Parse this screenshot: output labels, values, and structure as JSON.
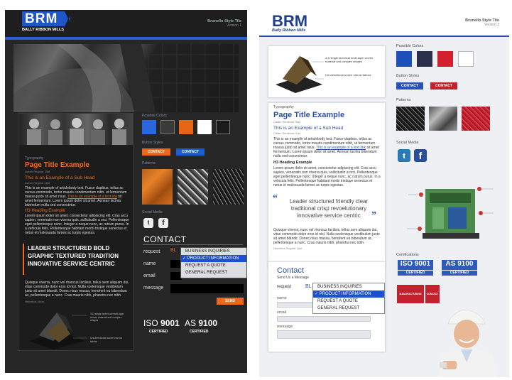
{
  "v1": {
    "logo": "BRM",
    "logo_sub": "BALLY RIBBON MILLS",
    "style_title": "Brunello Style Tile",
    "version": "Version 1",
    "possible_colors": "Possible Colors",
    "colors": [
      "#2b67dc",
      "#3a3a3a",
      "#e86417",
      "#ffffff",
      "#1b1b1b"
    ],
    "button_styles": "Button Styles",
    "btn_contact1": "CONTACT",
    "btn_contact2": "CONTACT",
    "patterns": "Patterns",
    "social_media": "Social Media",
    "typography": "Typography",
    "page_title": "Page Title Example",
    "page_title_note": "Avenir Regular 33pt",
    "sub_head": "This is an Example of a Sub Head",
    "sub_head_note": "Avenir Regular 18pt",
    "body1": "This is an example of articlebody text. Fusce dapibus, tellus ac cursus commodo, tortor mauris condimentum nibh, ut fermentum massa justo sit amet risus.",
    "body1_link": "This is an example of a text link",
    "body1_end": "sit amet fermentum. Lorem ipsum dolor sit amet. Aenean lacinia bibendum nulla sed consectetur.",
    "h3": "H3 Heading Example",
    "body2": "Lorem ipsum dolor sit amet, consectetur adipiscing elit. Cras arcu sapien, venenatis non viverra quis, sollicitudin a orci. Pellentesque eget pellentesque nunc. Integer a neque nunc, ac rutrum purus. In a vehicula felis. Pellentesque habitant morbi tristique senectus et netus et malesuada fames ac turpis egestas.",
    "quote": "LEADER STRUCTURED BOLD GRAPHIC TEXTURED TRADITION INNOVATIVE SERVICE CENTRIC",
    "body3": "Quisque viverra, nunc vel rhoncus facilisis, tellus sem aliquam dui, vitae commodo dolor eros id nisl. Nulla scelerisque vestibulum justo sit amet blandit. Donec risus massa, hendrerit eu bibendum ac, pellentesque a nunc. Cras mauris nibh, pharetra nec nibh.",
    "body3_note": "Helvetica Neue",
    "product_label1": "3-D single technical multi-layer woven material and complex shapes",
    "product_label2": "Uni-directional woven narrow fabrics",
    "contact_title": "CONTACT",
    "request_label": "request",
    "request_value": "BL",
    "name_label": "name",
    "email_label": "email",
    "message_label": "message",
    "dropdown": [
      "BUSINESS INQUIRIES",
      "PRODUCT INFORMATION",
      "REQUEST A QUOTE",
      "GENERAL REQUEST"
    ],
    "send": "SEND",
    "iso_label": "ISO",
    "iso_num": "9001",
    "as_label": "AS",
    "as_num": "9100",
    "certified1": "CERTIFIED",
    "certified2": "CERTIFIED"
  },
  "v2": {
    "logo": "BRM",
    "logo_sub": "Bally Ribbon Mills",
    "style_title": "Brunello Style Tile",
    "version": "Version 2",
    "possible_colors": "Possible Colors",
    "colors": [
      "#1e4fb8",
      "#2a2f4a",
      "#d2202f",
      "#ffffff"
    ],
    "button_styles": "Button Styles",
    "btn_contact1": "CONTACT",
    "btn_contact2": "CONTACT",
    "patterns": "Patterns",
    "social_media": "Social Media",
    "product_label1": "3-D single technical multi-layer woven material and complex shapes",
    "product_label2": "Uni-directional woven narrow fabrics",
    "typography": "Typography",
    "page_title": "Page Title Example",
    "page_title_note": "Calibri Semibold 36pt",
    "sub_head": "This is an Example of a Sub Head",
    "sub_head_note": "Calibri Semibold 20pt",
    "body1": "This is an example of articlebody text. Fusce dapibus, tellus ac cursus commodo, tortor mauris condimentum nibh, ut fermentum massa justo sit amet risus.",
    "body1_link": "This is an example of a text link",
    "body1_end": "sit amet fermentum. Lorem ipsum dolor sit amet. Aenean lacinia bibendum nulla sed consectetur.",
    "h3": "H3 Heading Example",
    "body2": "Lorem ipsum dolor sit amet, consectetur adipiscing elit. Cras arcu sapien, venenatis non viverra quis, sollicitudin a orci. Pellentesque eget pellentesque nunc. Integer a neque nunc, ac rutrum purus. In a vehicula felis. Pellentesque habitant morbi tristique senectus et netus et malesuada fames ac turpis egestas.",
    "quote": "Leader structured friendly clear traditional crisp revoelutionary innovative service centric",
    "body3": "Quisque viverra, nunc vel rhoncus facilisis, tellus sem aliquam dui, vitae commodo dolor eros id nisl. Nulla scelerisque vestibulum justo sit amet blandit. Donec risus massa, hendrerit eu bibendum ac, pellentesque a nunc. Cras mauris nibh, pharetra nec nibh.",
    "body3_note": "Helvetica Regular 14pt",
    "contact_title": "Contact",
    "contact_sub": "Send Us a Message",
    "request_label": "request",
    "request_value": "BL",
    "name_label": "name",
    "email_label": "email",
    "message_label": "message",
    "dropdown": [
      "BUSINESS INQUIRIES",
      "PRODUCT INFORMATION",
      "REQUEST A QUOTE",
      "GENERAL REQUEST"
    ],
    "certifications": "Certifications",
    "iso_label": "ISO",
    "iso_num": "9001",
    "as_label": "AS",
    "as_num": "9100",
    "certified1": "CERTIFIED",
    "certified2": "CERTIFIED",
    "tag_manufacturing": "MANUFACTURING",
    "tag_contact": "CONTACT"
  }
}
